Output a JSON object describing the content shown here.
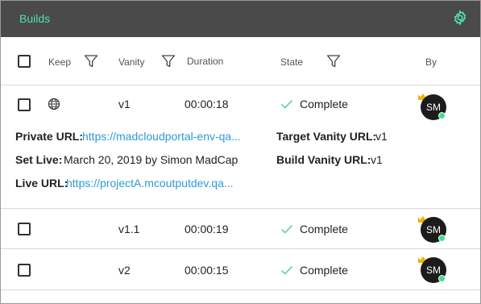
{
  "header": {
    "title": "Builds",
    "settings_icon": "gear-icon"
  },
  "columns": {
    "keep": "Keep",
    "vanity": "Vanity",
    "duration": "Duration",
    "state": "State",
    "by": "By"
  },
  "builds": [
    {
      "vanity": "v1",
      "duration": "00:00:18",
      "state": "Complete",
      "by_initials": "SM",
      "details": {
        "private_url_label": "Private URL:",
        "private_url": "https://madcloudportal-env-qa...",
        "target_vanity_label": "Target Vanity URL:",
        "target_vanity": "v1",
        "set_live_label": "Set Live:",
        "set_live": "March 20, 2019 by Simon MadCap",
        "build_vanity_label": "Build Vanity URL:",
        "build_vanity": "v1",
        "live_url_label": "Live URL:",
        "live_url": "https://projectA.mcoutputdev.qa..."
      }
    },
    {
      "vanity": "v1.1",
      "duration": "00:00:19",
      "state": "Complete",
      "by_initials": "SM"
    },
    {
      "vanity": "v2",
      "duration": "00:00:15",
      "state": "Complete",
      "by_initials": "SM"
    }
  ],
  "colors": {
    "accent": "#4fe0b0",
    "header_bg": "#4a4a4a",
    "link": "#2c9ad8",
    "check": "#4cc9a0",
    "online": "#3ee08f",
    "crown": "#f0b400"
  }
}
